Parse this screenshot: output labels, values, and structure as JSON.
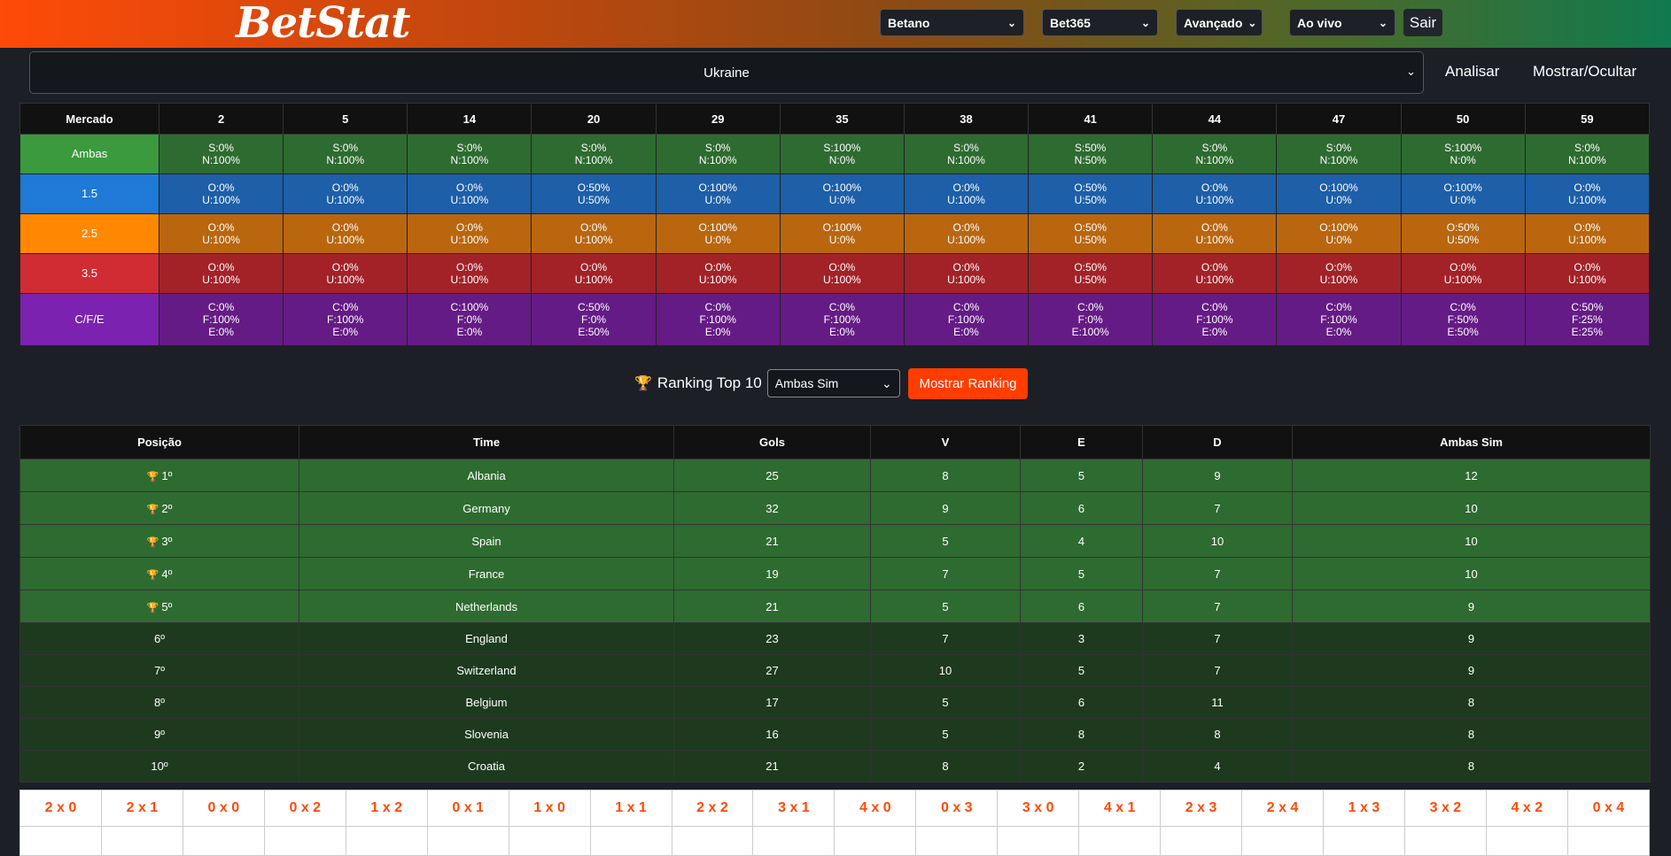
{
  "header": {
    "logo": "BetStat",
    "selects": [
      {
        "value": "Betano"
      },
      {
        "value": "Bet365"
      },
      {
        "value": "Avançado"
      },
      {
        "value": "Ao vivo"
      }
    ],
    "logout_label": "Sair"
  },
  "filter": {
    "country": "Ukraine",
    "analyze_label": "Analisar",
    "toggle_label": "Mostrar/Ocultar"
  },
  "market_table": {
    "header_label": "Mercado",
    "columns": [
      "2",
      "5",
      "14",
      "20",
      "29",
      "35",
      "38",
      "41",
      "44",
      "47",
      "50",
      "59"
    ],
    "rows": [
      {
        "label": "Ambas",
        "cells": [
          [
            "S:0%",
            "N:100%"
          ],
          [
            "S:0%",
            "N:100%"
          ],
          [
            "S:0%",
            "N:100%"
          ],
          [
            "S:0%",
            "N:100%"
          ],
          [
            "S:0%",
            "N:100%"
          ],
          [
            "S:100%",
            "N:0%"
          ],
          [
            "S:0%",
            "N:100%"
          ],
          [
            "S:50%",
            "N:50%"
          ],
          [
            "S:0%",
            "N:100%"
          ],
          [
            "S:0%",
            "N:100%"
          ],
          [
            "S:100%",
            "N:0%"
          ],
          [
            "S:0%",
            "N:100%"
          ]
        ]
      },
      {
        "label": "1.5",
        "cells": [
          [
            "O:0%",
            "U:100%"
          ],
          [
            "O:0%",
            "U:100%"
          ],
          [
            "O:0%",
            "U:100%"
          ],
          [
            "O:50%",
            "U:50%"
          ],
          [
            "O:100%",
            "U:0%"
          ],
          [
            "O:100%",
            "U:0%"
          ],
          [
            "O:0%",
            "U:100%"
          ],
          [
            "O:50%",
            "U:50%"
          ],
          [
            "O:0%",
            "U:100%"
          ],
          [
            "O:100%",
            "U:0%"
          ],
          [
            "O:100%",
            "U:0%"
          ],
          [
            "O:0%",
            "U:100%"
          ]
        ]
      },
      {
        "label": "2.5",
        "cells": [
          [
            "O:0%",
            "U:100%"
          ],
          [
            "O:0%",
            "U:100%"
          ],
          [
            "O:0%",
            "U:100%"
          ],
          [
            "O:0%",
            "U:100%"
          ],
          [
            "O:100%",
            "U:0%"
          ],
          [
            "O:100%",
            "U:0%"
          ],
          [
            "O:0%",
            "U:100%"
          ],
          [
            "O:50%",
            "U:50%"
          ],
          [
            "O:0%",
            "U:100%"
          ],
          [
            "O:100%",
            "U:0%"
          ],
          [
            "O:50%",
            "U:50%"
          ],
          [
            "O:0%",
            "U:100%"
          ]
        ]
      },
      {
        "label": "3.5",
        "cells": [
          [
            "O:0%",
            "U:100%"
          ],
          [
            "O:0%",
            "U:100%"
          ],
          [
            "O:0%",
            "U:100%"
          ],
          [
            "O:0%",
            "U:100%"
          ],
          [
            "O:0%",
            "U:100%"
          ],
          [
            "O:0%",
            "U:100%"
          ],
          [
            "O:0%",
            "U:100%"
          ],
          [
            "O:50%",
            "U:50%"
          ],
          [
            "O:0%",
            "U:100%"
          ],
          [
            "O:0%",
            "U:100%"
          ],
          [
            "O:0%",
            "U:100%"
          ],
          [
            "O:0%",
            "U:100%"
          ]
        ]
      },
      {
        "label": "C/F/E",
        "cells": [
          [
            "C:0%",
            "F:100%",
            "E:0%"
          ],
          [
            "C:0%",
            "F:100%",
            "E:0%"
          ],
          [
            "C:100%",
            "F:0%",
            "E:0%"
          ],
          [
            "C:50%",
            "F:0%",
            "E:50%"
          ],
          [
            "C:0%",
            "F:100%",
            "E:0%"
          ],
          [
            "C:0%",
            "F:100%",
            "E:0%"
          ],
          [
            "C:0%",
            "F:100%",
            "E:0%"
          ],
          [
            "C:0%",
            "F:0%",
            "E:100%"
          ],
          [
            "C:0%",
            "F:100%",
            "E:0%"
          ],
          [
            "C:0%",
            "F:100%",
            "E:0%"
          ],
          [
            "C:0%",
            "F:50%",
            "E:50%"
          ],
          [
            "C:50%",
            "F:25%",
            "E:25%"
          ]
        ]
      }
    ]
  },
  "ranking_controls": {
    "title": "Ranking Top 10",
    "select_value": "Ambas Sim",
    "button_label": "Mostrar Ranking"
  },
  "ranking_table": {
    "headers": [
      "Posição",
      "Time",
      "Gols",
      "V",
      "E",
      "D",
      "Ambas Sim"
    ],
    "rows": [
      {
        "pos": "1º",
        "team": "Albania",
        "gols": "25",
        "v": "8",
        "e": "5",
        "d": "9",
        "ambas": "12",
        "trophy": true
      },
      {
        "pos": "2º",
        "team": "Germany",
        "gols": "32",
        "v": "9",
        "e": "6",
        "d": "7",
        "ambas": "10",
        "trophy": true
      },
      {
        "pos": "3º",
        "team": "Spain",
        "gols": "21",
        "v": "5",
        "e": "4",
        "d": "10",
        "ambas": "10",
        "trophy": true
      },
      {
        "pos": "4º",
        "team": "France",
        "gols": "19",
        "v": "7",
        "e": "5",
        "d": "7",
        "ambas": "10",
        "trophy": true
      },
      {
        "pos": "5º",
        "team": "Netherlands",
        "gols": "21",
        "v": "5",
        "e": "6",
        "d": "7",
        "ambas": "9",
        "trophy": true
      },
      {
        "pos": "6º",
        "team": "England",
        "gols": "23",
        "v": "7",
        "e": "3",
        "d": "7",
        "ambas": "9",
        "trophy": false
      },
      {
        "pos": "7º",
        "team": "Switzerland",
        "gols": "27",
        "v": "10",
        "e": "5",
        "d": "7",
        "ambas": "9",
        "trophy": false
      },
      {
        "pos": "8º",
        "team": "Belgium",
        "gols": "17",
        "v": "5",
        "e": "6",
        "d": "11",
        "ambas": "8",
        "trophy": false
      },
      {
        "pos": "9º",
        "team": "Slovenia",
        "gols": "16",
        "v": "5",
        "e": "8",
        "d": "8",
        "ambas": "8",
        "trophy": false
      },
      {
        "pos": "10º",
        "team": "Croatia",
        "gols": "21",
        "v": "8",
        "e": "2",
        "d": "4",
        "ambas": "8",
        "trophy": false
      }
    ]
  },
  "scores": [
    "2 x 0",
    "2 x 1",
    "0 x 0",
    "0 x 2",
    "1 x 2",
    "0 x 1",
    "1 x 0",
    "1 x 1",
    "2 x 2",
    "3 x 1",
    "4 x 0",
    "0 x 3",
    "3 x 0",
    "4 x 1",
    "2 x 3",
    "2 x 4",
    "1 x 3",
    "3 x 2",
    "4 x 2",
    "0 x 4"
  ],
  "colors": {
    "accent": "#ff3d00",
    "ambas": "#2e6b30",
    "over15": "#1d5fa8",
    "over25": "#b9660f",
    "over35": "#a22228",
    "cfe": "#651b85"
  }
}
